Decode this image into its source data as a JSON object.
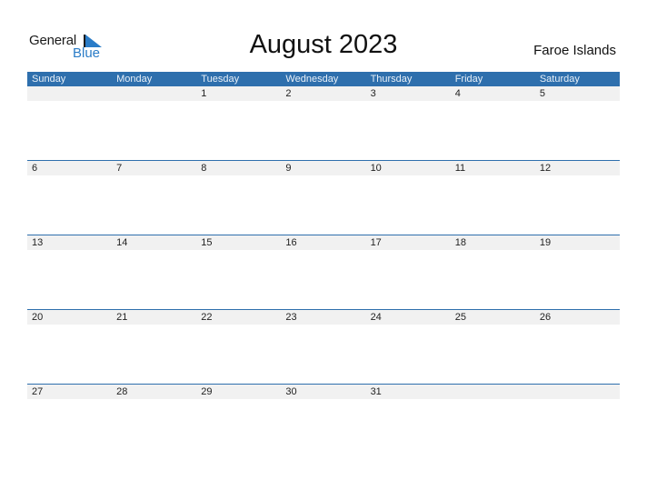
{
  "logo": {
    "word1": "General",
    "word2": "Blue"
  },
  "title": "August 2023",
  "country": "Faroe Islands",
  "weekdays": [
    "Sunday",
    "Monday",
    "Tuesday",
    "Wednesday",
    "Thursday",
    "Friday",
    "Saturday"
  ],
  "weeks": [
    [
      "",
      "",
      "1",
      "2",
      "3",
      "4",
      "5"
    ],
    [
      "6",
      "7",
      "8",
      "9",
      "10",
      "11",
      "12"
    ],
    [
      "13",
      "14",
      "15",
      "16",
      "17",
      "18",
      "19"
    ],
    [
      "20",
      "21",
      "22",
      "23",
      "24",
      "25",
      "26"
    ],
    [
      "27",
      "28",
      "29",
      "30",
      "31",
      "",
      ""
    ]
  ],
  "colors": {
    "header": "#2e6fad",
    "logo_blue": "#2a7cc7",
    "row_bg": "#f1f1f1"
  }
}
